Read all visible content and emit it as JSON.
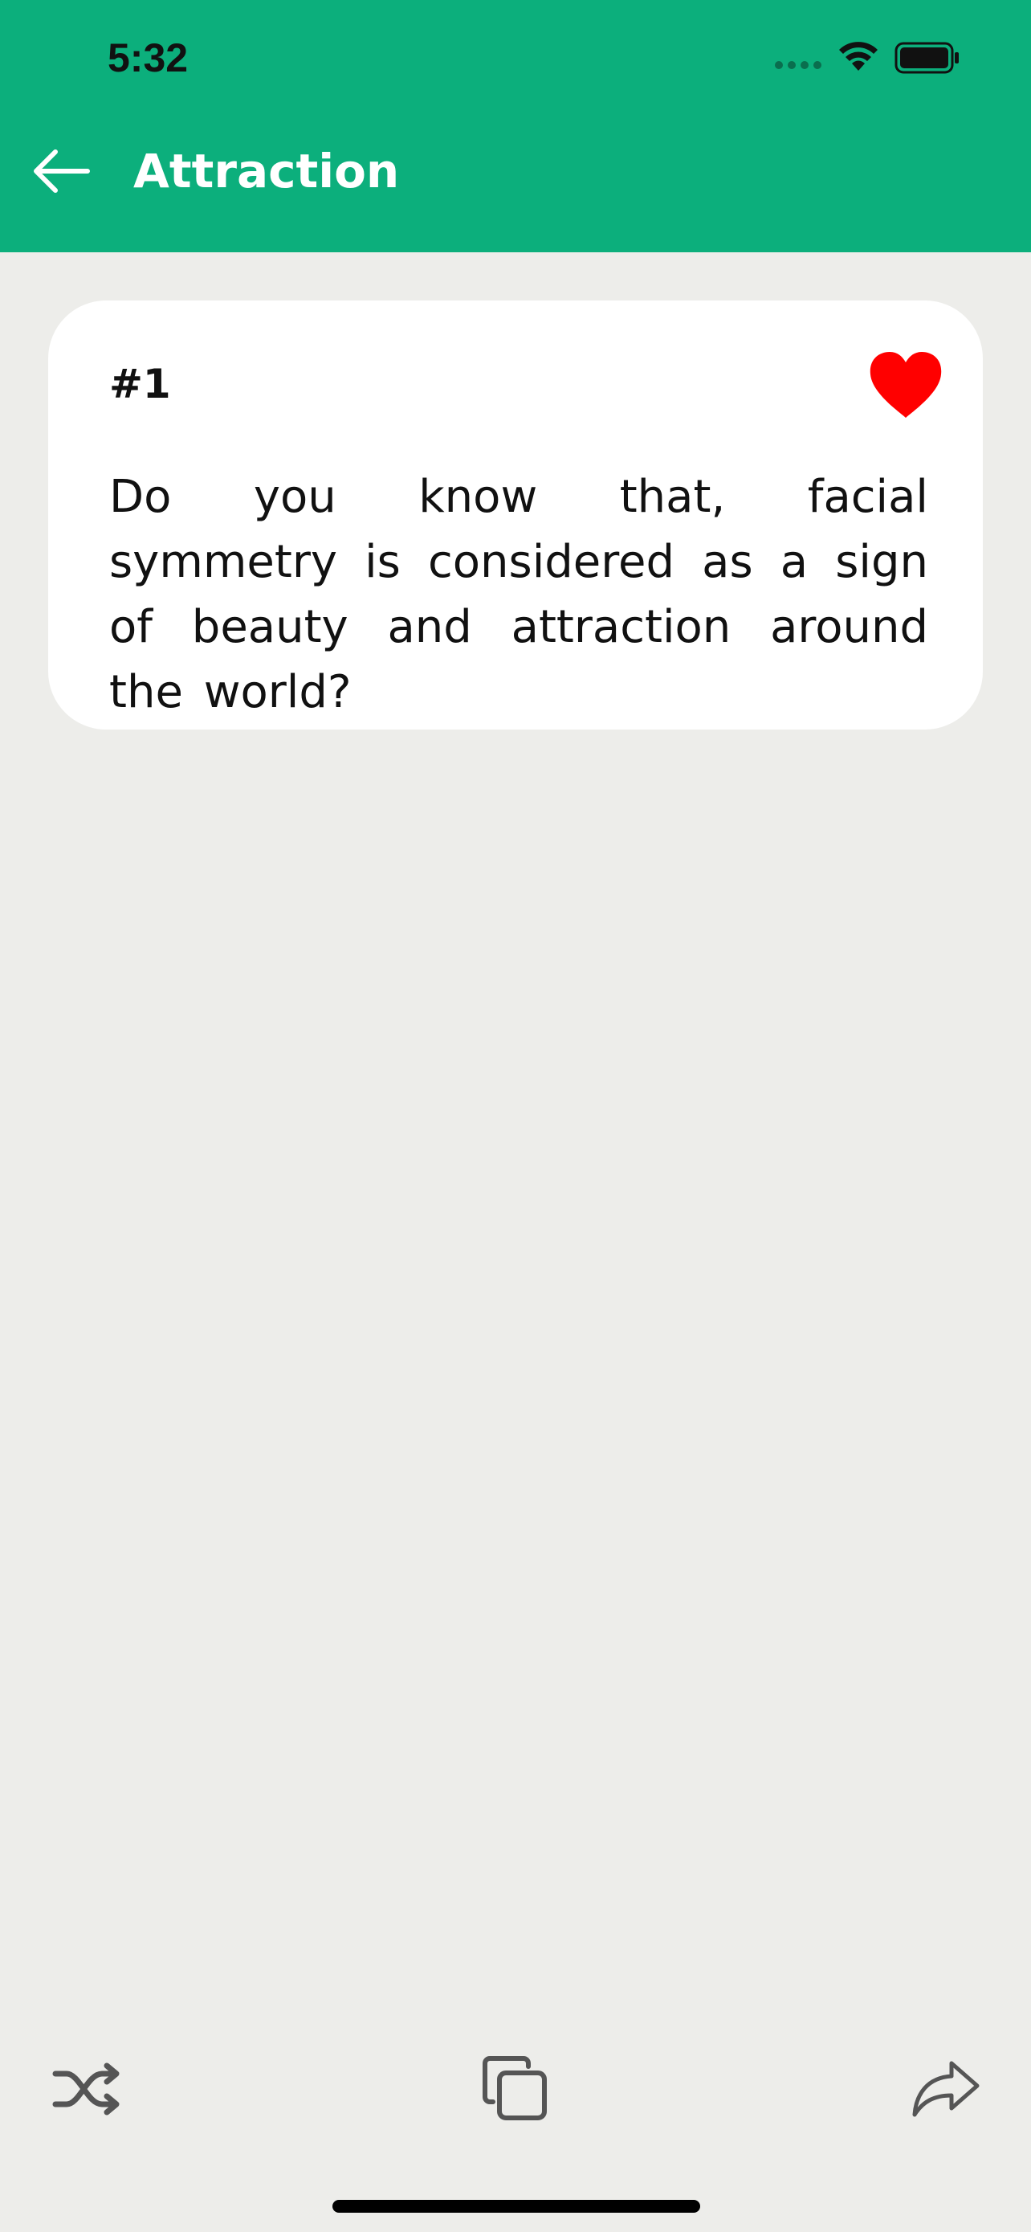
{
  "status_bar": {
    "time": "5:32"
  },
  "header": {
    "title": "Attraction",
    "back_icon": "arrow-left-icon",
    "background_color": "#0caf7c"
  },
  "card": {
    "number": "#1",
    "text": "Do you know that, facial symmetry is considered as a sign of beauty and attraction around the world?",
    "favorite_icon": "heart-icon",
    "favorite_color": "#ff0000",
    "favorited": true
  },
  "toolbar": {
    "shuffle_icon": "shuffle-icon",
    "copy_icon": "copy-icon",
    "share_icon": "share-icon"
  }
}
